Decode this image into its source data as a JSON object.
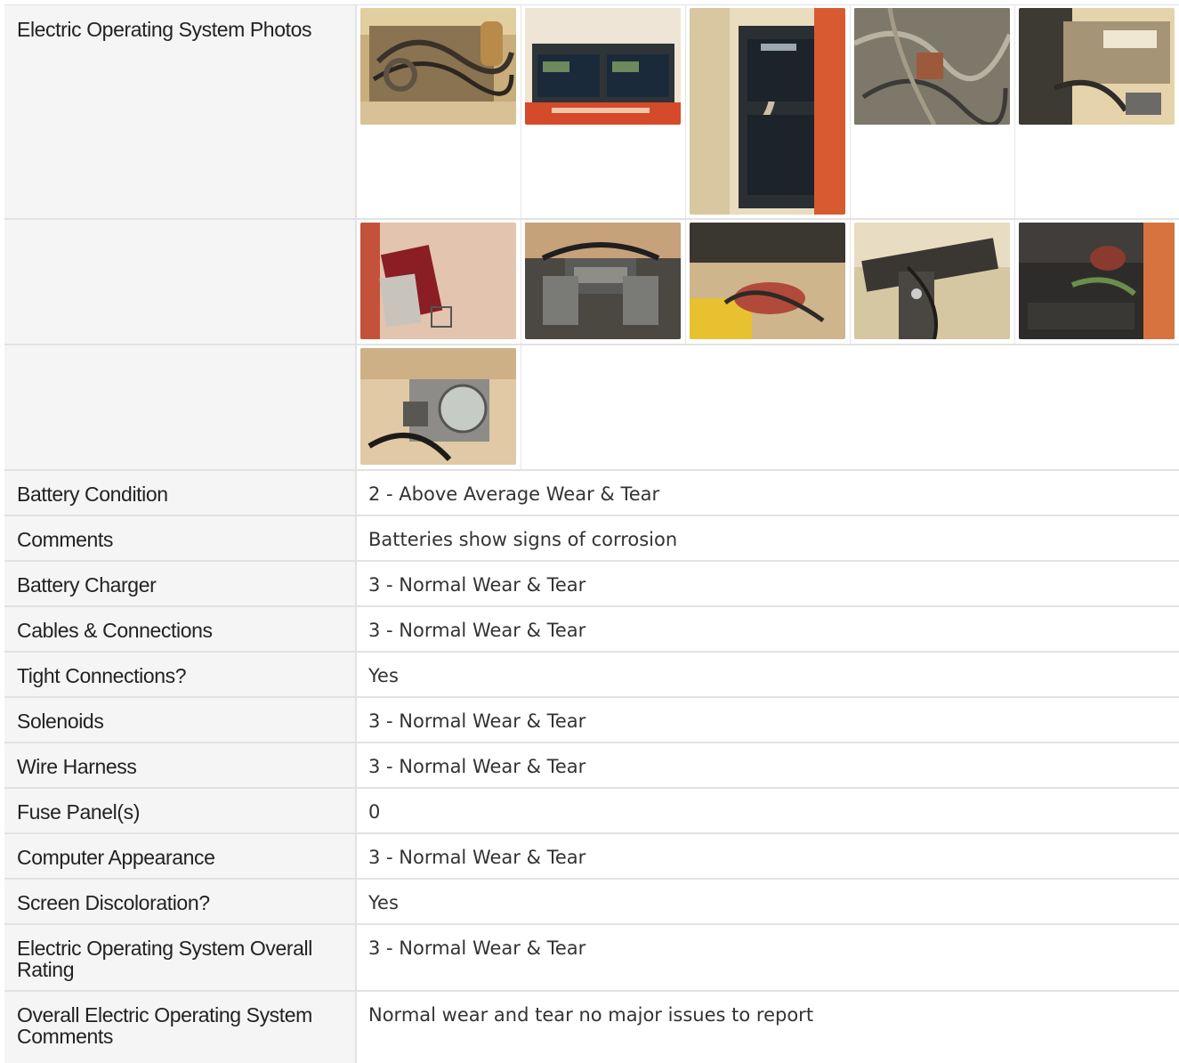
{
  "section": {
    "photos_label": "Electric Operating System Photos",
    "photo_rows": [
      [
        {
          "name": "photo-battery-compartment-cables",
          "tall": false
        },
        {
          "name": "photo-two-batteries-tray",
          "tall": false
        },
        {
          "name": "photo-batteries-vertical",
          "tall": true
        },
        {
          "name": "photo-wire-bundle",
          "tall": false
        },
        {
          "name": "photo-charger-box",
          "tall": false
        }
      ],
      [
        {
          "name": "photo-red-terminal-cover",
          "tall": false
        },
        {
          "name": "photo-battery-connector",
          "tall": false
        },
        {
          "name": "photo-red-cable-boot",
          "tall": false
        },
        {
          "name": "photo-solenoid-wiring",
          "tall": false
        },
        {
          "name": "photo-corroded-terminal",
          "tall": false
        }
      ],
      [
        {
          "name": "photo-meter-gauge",
          "tall": false
        }
      ]
    ]
  },
  "fields": [
    {
      "label": "Battery Condition",
      "value": "2 - Above Average Wear & Tear"
    },
    {
      "label": "Comments",
      "value": "Batteries show signs of corrosion"
    },
    {
      "label": "Battery Charger",
      "value": "3 - Normal Wear & Tear"
    },
    {
      "label": "Cables & Connections",
      "value": "3 - Normal Wear & Tear"
    },
    {
      "label": "Tight Connections?",
      "value": "Yes"
    },
    {
      "label": "Solenoids",
      "value": "3 - Normal Wear & Tear"
    },
    {
      "label": "Wire Harness",
      "value": "3 - Normal Wear & Tear"
    },
    {
      "label": "Fuse Panel(s)",
      "value": "0"
    },
    {
      "label": "Computer Appearance",
      "value": "3 - Normal Wear & Tear"
    },
    {
      "label": "Screen Discoloration?",
      "value": "Yes"
    },
    {
      "label": "Electric Operating System Overall Rating",
      "value": "3 - Normal Wear & Tear"
    },
    {
      "label": "Overall Electric Operating System Comments",
      "value": "Normal wear and tear no major issues to report"
    }
  ]
}
